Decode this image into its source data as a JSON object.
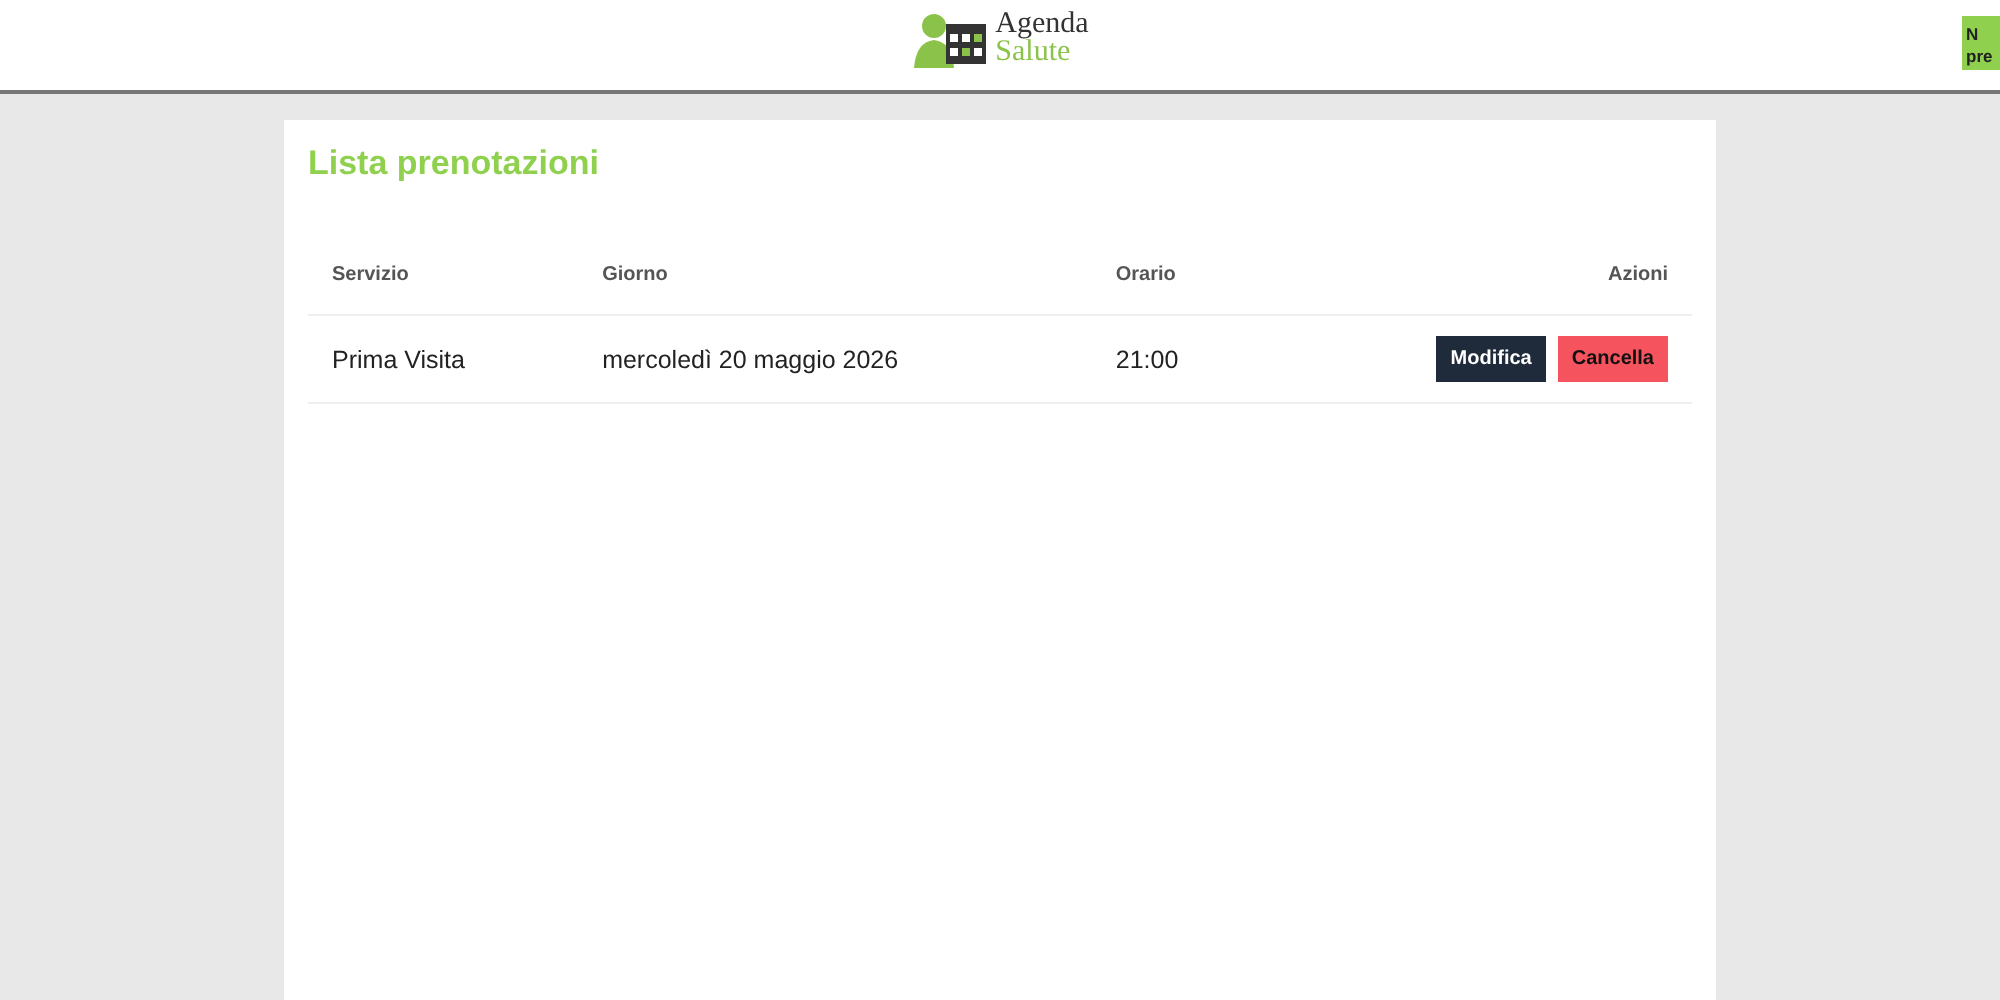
{
  "header": {
    "logo_line_1": "Agenda",
    "logo_line_2": "Salute",
    "action_button_lines": [
      "N",
      "pre"
    ]
  },
  "panel": {
    "title": "Lista prenotazioni",
    "table": {
      "columns": [
        "Servizio",
        "Giorno",
        "Orario",
        "Azioni"
      ],
      "rows": [
        {
          "service": "Prima Visita",
          "day": "mercoledì 20 maggio 2026",
          "time": "21:00",
          "actions": [
            {
              "kind": "edit",
              "label": "Modifica"
            },
            {
              "kind": "delete",
              "label": "Cancella"
            }
          ]
        }
      ]
    }
  }
}
